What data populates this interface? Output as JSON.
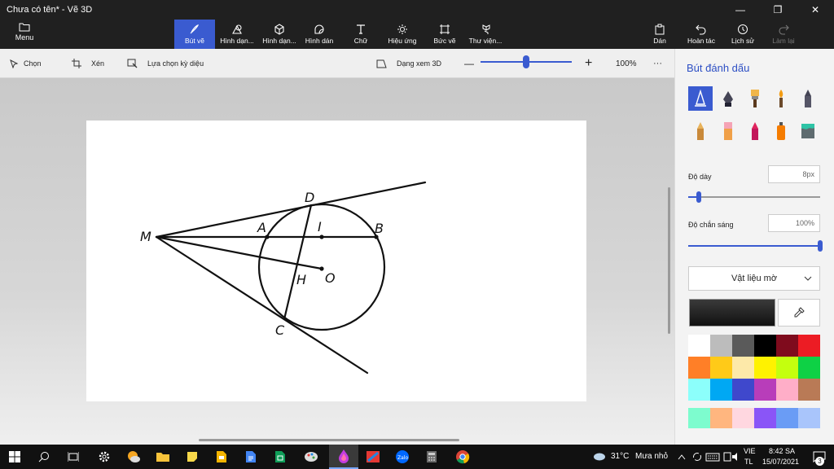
{
  "window": {
    "title": "Chưa có tên* - Vẽ 3D",
    "minimize": "—",
    "maximize": "❐",
    "close": "✕"
  },
  "ribbon": {
    "menu_label": "Menu",
    "tools": [
      {
        "label": "Bút vẽ",
        "icon": "brush-icon"
      },
      {
        "label": "Hình dạn...",
        "icon": "shapes-2d-icon"
      },
      {
        "label": "Hình dạn...",
        "icon": "shapes-3d-icon"
      },
      {
        "label": "Hình dán",
        "icon": "stickers-icon"
      },
      {
        "label": "Chữ",
        "icon": "text-icon"
      },
      {
        "label": "Hiệu ứng",
        "icon": "effects-icon"
      },
      {
        "label": "Bức vẽ",
        "icon": "canvas-icon"
      },
      {
        "label": "Thư viện...",
        "icon": "library-icon"
      }
    ],
    "paste": "Dán",
    "undo": "Hoàn tác",
    "history": "Lịch sử",
    "redo": "Làm lại"
  },
  "subbar": {
    "select": "Chọn",
    "crop": "Xén",
    "magic_select": "Lựa chọn kỳ diệu",
    "view3d": "Dạng xem 3D",
    "zoom_minus": "—",
    "zoom_plus": "+",
    "zoom": "100%",
    "zoom_fraction": 0.5,
    "more": "···"
  },
  "panel": {
    "title": "Bút đánh dấu",
    "thickness_label": "Độ dày",
    "thickness_value": "8px",
    "thickness_fraction": 0.08,
    "opacity_label": "Độ chắn sáng",
    "opacity_value": "100%",
    "opacity_fraction": 1.0,
    "material": "Vật liệu mờ",
    "accent": "#3a5bd0",
    "palette": [
      "#ffffff",
      "#bcbcbc",
      "#5a5a5a",
      "#000000",
      "#7f0b1d",
      "#ec1c24",
      "#ff7f27",
      "#ffca18",
      "#fde9a9",
      "#fff200",
      "#c4ff0e",
      "#0ed145",
      "#8cfffb",
      "#00a8f3",
      "#3f48cc",
      "#b83dba",
      "#ffaec8",
      "#b97a56"
    ],
    "custom_palette": [
      "#7dfcce",
      "#ffb67f",
      "#ffd7e0",
      "#8a55f7",
      "#6a9cf5",
      "#a9c5fb"
    ]
  },
  "drawing": {
    "labels": {
      "M": "M",
      "A": "A",
      "I": "I",
      "B": "B",
      "D": "D",
      "H": "H",
      "O": "O",
      "C": "C"
    }
  },
  "taskbar": {
    "weather_temp": "31°C",
    "weather_text": "Mưa nhỏ",
    "lang_top": "VIE",
    "lang_bottom": "TL",
    "time": "8:42 SA",
    "date": "15/07/2021",
    "notif_count": "3"
  }
}
